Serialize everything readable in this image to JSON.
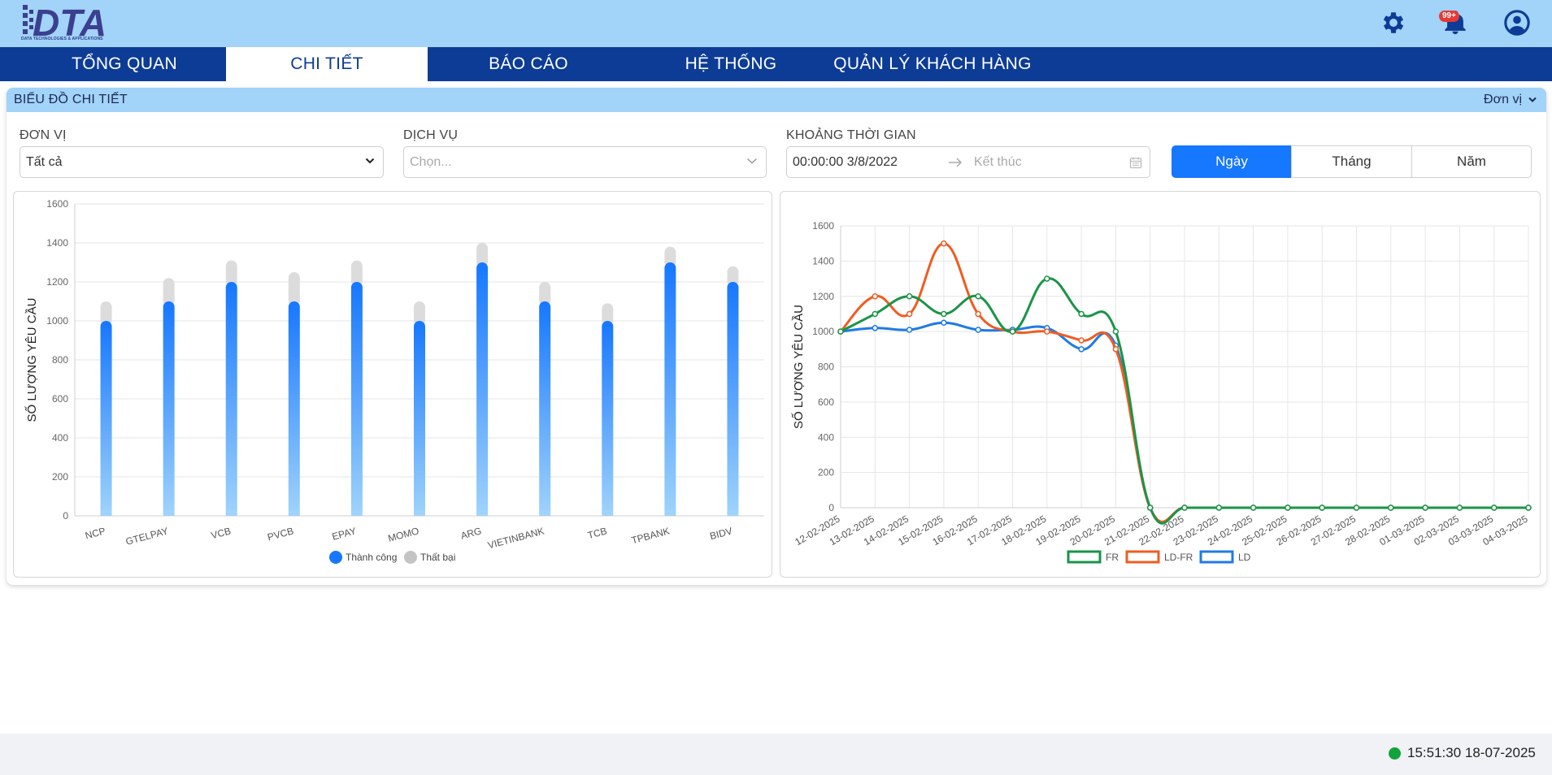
{
  "header": {
    "logo_text": "DTA",
    "logo_subtext": "DATA TECHNOLOGIES & APPLICATIONS",
    "notification_count": "99+",
    "icons": [
      "gear-icon",
      "bell-icon",
      "user-circle-icon"
    ]
  },
  "nav": {
    "tabs": [
      {
        "label": "TỔNG QUAN"
      },
      {
        "label": "CHI TIẾT",
        "active": true
      },
      {
        "label": "BÁO CÁO"
      },
      {
        "label": "HỆ THỐNG"
      },
      {
        "label": "QUẢN LÝ KHÁCH HÀNG"
      }
    ]
  },
  "panel": {
    "title": "BIỂU ĐỒ CHI TIẾT",
    "unit_toggle": "Đơn vị"
  },
  "filters": {
    "unit_label": "ĐƠN VỊ",
    "unit_value": "Tất cả",
    "service_label": "DỊCH VỤ",
    "service_placeholder": "Chọn...",
    "time_label": "KHOẢNG THỜI GIAN",
    "time_start": "00:00:00 3/8/2022",
    "time_end_placeholder": "Kết thúc",
    "granularity": [
      "Ngày",
      "Tháng",
      "Năm"
    ],
    "granularity_active": "Ngày"
  },
  "colors": {
    "header_bg": "#a2d3f9",
    "nav_bg": "#0d3c96",
    "accent": "#1677ff",
    "fail": "#d9d9d9",
    "fr": "#1a9447",
    "ldfr": "#ef5d22",
    "ld": "#1f7ae6",
    "status_online": "#12a33a"
  },
  "chart_data": [
    {
      "type": "bar",
      "categories": [
        "NCP",
        "GTELPAY",
        "VCB",
        "PVCB",
        "EPAY",
        "MOMO",
        "ARG",
        "VIETINBANK",
        "TCB",
        "TPBANK",
        "BIDV"
      ],
      "series": [
        {
          "name": "Thành công",
          "values": [
            1000,
            1100,
            1200,
            1100,
            1200,
            1000,
            1300,
            1100,
            1000,
            1300,
            1200
          ]
        },
        {
          "name": "Thất bại",
          "values": [
            100,
            120,
            110,
            150,
            110,
            100,
            100,
            100,
            90,
            80,
            80
          ]
        }
      ],
      "stacked": true,
      "ylabel": "SỐ LƯỢNG YÊU CẦU",
      "ylim": [
        0,
        1600
      ],
      "yticks": [
        0,
        200,
        400,
        600,
        800,
        1000,
        1200,
        1400,
        1600
      ],
      "legend": "bottom"
    },
    {
      "type": "line",
      "x": [
        "12-02-2025",
        "13-02-2025",
        "14-02-2025",
        "15-02-2025",
        "16-02-2025",
        "17-02-2025",
        "18-02-2025",
        "19-02-2025",
        "20-02-2025",
        "21-02-2025",
        "22-02-2025",
        "23-02-2025",
        "24-02-2025",
        "25-02-2025",
        "26-02-2025",
        "27-02-2025",
        "28-02-2025",
        "01-03-2025",
        "02-03-2025",
        "03-03-2025",
        "04-03-2025"
      ],
      "series": [
        {
          "name": "FR",
          "values": [
            1000,
            1100,
            1200,
            1100,
            1200,
            1000,
            1300,
            1100,
            1000,
            0,
            0,
            0,
            0,
            0,
            0,
            0,
            0,
            0,
            0,
            0,
            0
          ]
        },
        {
          "name": "LD-FR",
          "values": [
            1000,
            1200,
            1100,
            1500,
            1100,
            1000,
            1000,
            950,
            900,
            0,
            0,
            0,
            0,
            0,
            0,
            0,
            0,
            0,
            0,
            0,
            0
          ]
        },
        {
          "name": "LD",
          "values": [
            1000,
            1020,
            1010,
            1050,
            1010,
            1010,
            1020,
            900,
            920,
            0,
            0,
            0,
            0,
            0,
            0,
            0,
            0,
            0,
            0,
            0,
            0
          ]
        }
      ],
      "ylabel": "SỐ LƯỢNG YÊU CẦU",
      "ylim": [
        0,
        1600
      ],
      "yticks": [
        0,
        200,
        400,
        600,
        800,
        1000,
        1200,
        1400,
        1600
      ],
      "grid": true,
      "legend": "bottom"
    }
  ],
  "status": {
    "timestamp": "15:51:30 18-07-2025"
  }
}
